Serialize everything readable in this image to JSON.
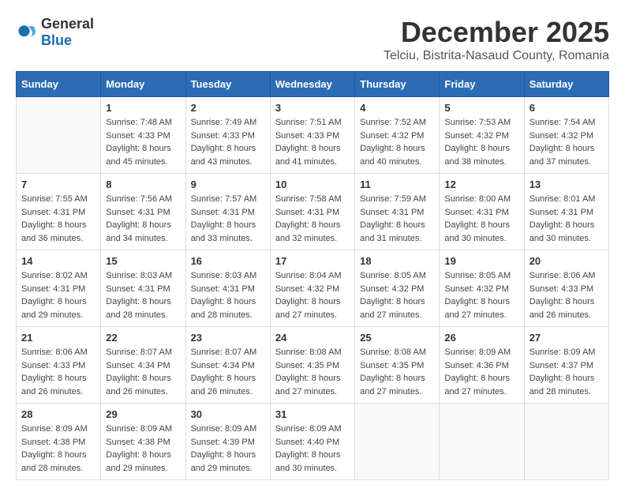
{
  "header": {
    "logo_general": "General",
    "logo_blue": "Blue",
    "month_year": "December 2025",
    "location": "Telciu, Bistrita-Nasaud County, Romania"
  },
  "weekdays": [
    "Sunday",
    "Monday",
    "Tuesday",
    "Wednesday",
    "Thursday",
    "Friday",
    "Saturday"
  ],
  "weeks": [
    [
      {
        "day": "",
        "info": ""
      },
      {
        "day": "1",
        "info": "Sunrise: 7:48 AM\nSunset: 4:33 PM\nDaylight: 8 hours\nand 45 minutes."
      },
      {
        "day": "2",
        "info": "Sunrise: 7:49 AM\nSunset: 4:33 PM\nDaylight: 8 hours\nand 43 minutes."
      },
      {
        "day": "3",
        "info": "Sunrise: 7:51 AM\nSunset: 4:33 PM\nDaylight: 8 hours\nand 41 minutes."
      },
      {
        "day": "4",
        "info": "Sunrise: 7:52 AM\nSunset: 4:32 PM\nDaylight: 8 hours\nand 40 minutes."
      },
      {
        "day": "5",
        "info": "Sunrise: 7:53 AM\nSunset: 4:32 PM\nDaylight: 8 hours\nand 38 minutes."
      },
      {
        "day": "6",
        "info": "Sunrise: 7:54 AM\nSunset: 4:32 PM\nDaylight: 8 hours\nand 37 minutes."
      }
    ],
    [
      {
        "day": "7",
        "info": "Sunrise: 7:55 AM\nSunset: 4:31 PM\nDaylight: 8 hours\nand 36 minutes."
      },
      {
        "day": "8",
        "info": "Sunrise: 7:56 AM\nSunset: 4:31 PM\nDaylight: 8 hours\nand 34 minutes."
      },
      {
        "day": "9",
        "info": "Sunrise: 7:57 AM\nSunset: 4:31 PM\nDaylight: 8 hours\nand 33 minutes."
      },
      {
        "day": "10",
        "info": "Sunrise: 7:58 AM\nSunset: 4:31 PM\nDaylight: 8 hours\nand 32 minutes."
      },
      {
        "day": "11",
        "info": "Sunrise: 7:59 AM\nSunset: 4:31 PM\nDaylight: 8 hours\nand 31 minutes."
      },
      {
        "day": "12",
        "info": "Sunrise: 8:00 AM\nSunset: 4:31 PM\nDaylight: 8 hours\nand 30 minutes."
      },
      {
        "day": "13",
        "info": "Sunrise: 8:01 AM\nSunset: 4:31 PM\nDaylight: 8 hours\nand 30 minutes."
      }
    ],
    [
      {
        "day": "14",
        "info": "Sunrise: 8:02 AM\nSunset: 4:31 PM\nDaylight: 8 hours\nand 29 minutes."
      },
      {
        "day": "15",
        "info": "Sunrise: 8:03 AM\nSunset: 4:31 PM\nDaylight: 8 hours\nand 28 minutes."
      },
      {
        "day": "16",
        "info": "Sunrise: 8:03 AM\nSunset: 4:31 PM\nDaylight: 8 hours\nand 28 minutes."
      },
      {
        "day": "17",
        "info": "Sunrise: 8:04 AM\nSunset: 4:32 PM\nDaylight: 8 hours\nand 27 minutes."
      },
      {
        "day": "18",
        "info": "Sunrise: 8:05 AM\nSunset: 4:32 PM\nDaylight: 8 hours\nand 27 minutes."
      },
      {
        "day": "19",
        "info": "Sunrise: 8:05 AM\nSunset: 4:32 PM\nDaylight: 8 hours\nand 27 minutes."
      },
      {
        "day": "20",
        "info": "Sunrise: 8:06 AM\nSunset: 4:33 PM\nDaylight: 8 hours\nand 26 minutes."
      }
    ],
    [
      {
        "day": "21",
        "info": "Sunrise: 8:06 AM\nSunset: 4:33 PM\nDaylight: 8 hours\nand 26 minutes."
      },
      {
        "day": "22",
        "info": "Sunrise: 8:07 AM\nSunset: 4:34 PM\nDaylight: 8 hours\nand 26 minutes."
      },
      {
        "day": "23",
        "info": "Sunrise: 8:07 AM\nSunset: 4:34 PM\nDaylight: 8 hours\nand 26 minutes."
      },
      {
        "day": "24",
        "info": "Sunrise: 8:08 AM\nSunset: 4:35 PM\nDaylight: 8 hours\nand 27 minutes."
      },
      {
        "day": "25",
        "info": "Sunrise: 8:08 AM\nSunset: 4:35 PM\nDaylight: 8 hours\nand 27 minutes."
      },
      {
        "day": "26",
        "info": "Sunrise: 8:09 AM\nSunset: 4:36 PM\nDaylight: 8 hours\nand 27 minutes."
      },
      {
        "day": "27",
        "info": "Sunrise: 8:09 AM\nSunset: 4:37 PM\nDaylight: 8 hours\nand 28 minutes."
      }
    ],
    [
      {
        "day": "28",
        "info": "Sunrise: 8:09 AM\nSunset: 4:38 PM\nDaylight: 8 hours\nand 28 minutes."
      },
      {
        "day": "29",
        "info": "Sunrise: 8:09 AM\nSunset: 4:38 PM\nDaylight: 8 hours\nand 29 minutes."
      },
      {
        "day": "30",
        "info": "Sunrise: 8:09 AM\nSunset: 4:39 PM\nDaylight: 8 hours\nand 29 minutes."
      },
      {
        "day": "31",
        "info": "Sunrise: 8:09 AM\nSunset: 4:40 PM\nDaylight: 8 hours\nand 30 minutes."
      },
      {
        "day": "",
        "info": ""
      },
      {
        "day": "",
        "info": ""
      },
      {
        "day": "",
        "info": ""
      }
    ]
  ]
}
